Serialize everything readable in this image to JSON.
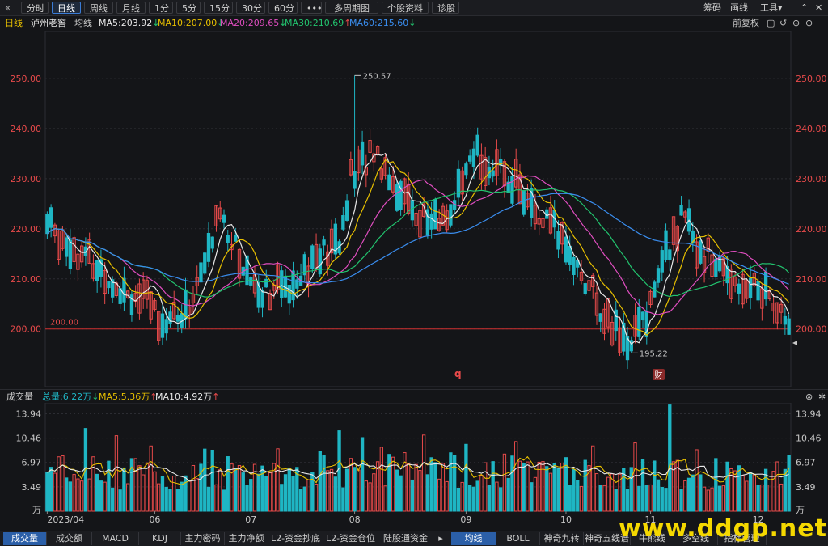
{
  "toolbar": {
    "back_icon": "«",
    "periods": [
      "分时",
      "日线",
      "周线",
      "月线",
      "1分",
      "5分",
      "15分",
      "30分",
      "60分",
      "•••",
      "多周期图",
      "个股资料",
      "诊股"
    ],
    "active_period": "日线",
    "right": [
      "筹码",
      "画线",
      "工具▾"
    ],
    "window_icons": [
      "⌃",
      "✕"
    ]
  },
  "info": {
    "period": "日线",
    "name": "泸州老窖",
    "avg_label": "均线",
    "ma5": "MA5:203.92",
    "ma10": "MA10:207.00",
    "ma20": "MA20:209.65",
    "ma30": "MA30:210.69",
    "ma60": "MA60:215.60",
    "ma5_arrow": "↓",
    "ma10_arrow": "↓",
    "ma20_arrow": "↓",
    "ma30_arrow": "↑",
    "ma60_arrow": "↓",
    "adjust": "前复权",
    "right_icons": [
      "▢",
      "↺",
      "⊕",
      "⊖"
    ],
    "colors": {
      "ma5": "#e8e8e8",
      "ma10": "#e8c000",
      "ma20": "#e04ec0",
      "ma30": "#22c36e",
      "ma60": "#3a8ef0",
      "up": "#e84a4a",
      "down": "#1fb6c4",
      "grid": "#2c2d33",
      "ref": "#d03030"
    }
  },
  "price_chart": {
    "ticks": [
      "250.00",
      "240.00",
      "230.00",
      "220.00",
      "210.00",
      "200.00"
    ],
    "tick_values": [
      250,
      240,
      230,
      220,
      210,
      200
    ],
    "ylim": [
      188.5,
      259.5
    ],
    "ref_line_label": "200.00",
    "ref_line_value": 200,
    "high_label": "250.57",
    "low_label": "195.22",
    "q_marker": "q",
    "fin_marker": "财"
  },
  "volume": {
    "title": "成交量",
    "total": "总量:6.22万",
    "total_arrow": "↓",
    "ma5": "MA5:5.36万",
    "ma5_arrow": "↑",
    "ma10": "MA10:4.92万",
    "ma10_arrow": "↑",
    "ticks": [
      "13.94",
      "10.46",
      "6.97",
      "3.49",
      "万"
    ],
    "tick_values": [
      13.94,
      10.46,
      6.97,
      3.49
    ],
    "ymax": 15.5,
    "close_icon": "⊗",
    "gear_icon": "✲"
  },
  "xaxis": {
    "labels": [
      "2023/04",
      "06",
      "07",
      "08",
      "09",
      "10",
      "11",
      "12"
    ],
    "label_indices": [
      0,
      28,
      53,
      80,
      109,
      135,
      157,
      185
    ]
  },
  "bottom_tabs_left": [
    "成交量",
    "成交额",
    "MACD",
    "KDJ",
    "主力密码",
    "主力净额",
    "L2-资金抄底",
    "L2-资金仓位",
    "陆股通资金"
  ],
  "bottom_tabs_right": [
    "均线",
    "BOLL",
    "神奇九转",
    "神奇五线谱",
    "牛熊线",
    "多空线",
    "指标管理"
  ],
  "bottom_nav_icon": "▸",
  "watermark": "www.ddgp.net"
}
